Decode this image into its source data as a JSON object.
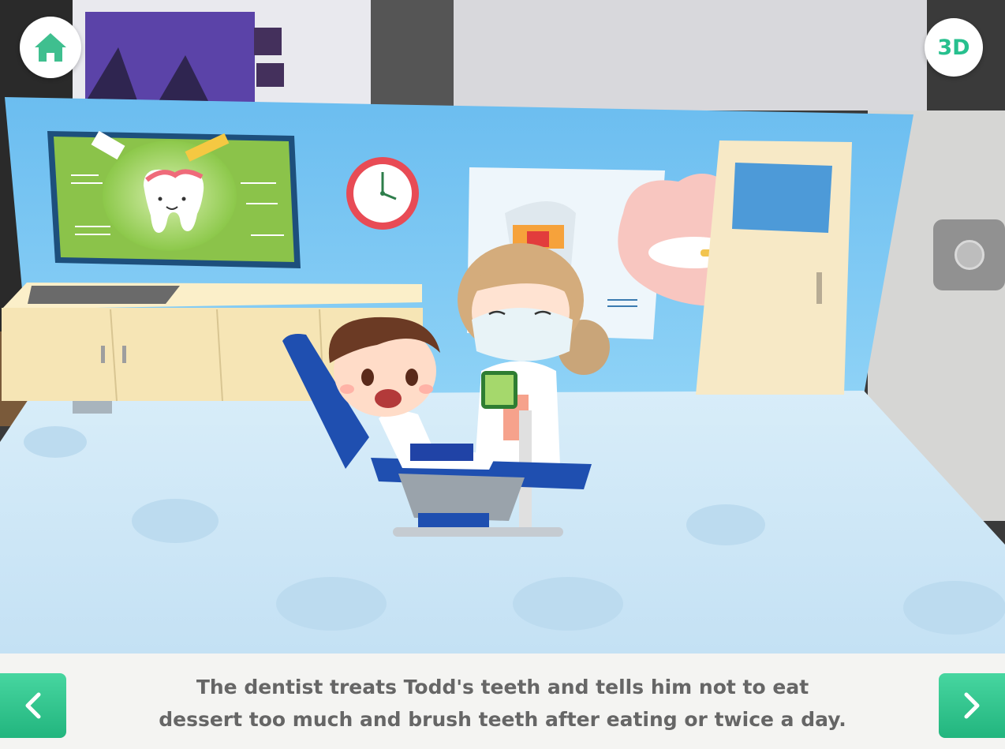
{
  "app": {
    "caption_line1": "The dentist treats Todd's teeth and tells him not to eat",
    "caption_line2": "dessert too much and brush teeth after eating or twice a day."
  },
  "toolbar": {
    "home_icon": "home-icon",
    "view_3d_label": "3D",
    "capture_icon": "camera-shutter-icon"
  },
  "navigation": {
    "prev_icon": "chevron-left-icon",
    "next_icon": "chevron-right-icon"
  },
  "colors": {
    "accent_green": "#27c08e",
    "button_green": "#2fc48a",
    "caption_text": "#666666",
    "wall_blue": "#74c4f2",
    "floor_blue": "#cfe7f7"
  }
}
